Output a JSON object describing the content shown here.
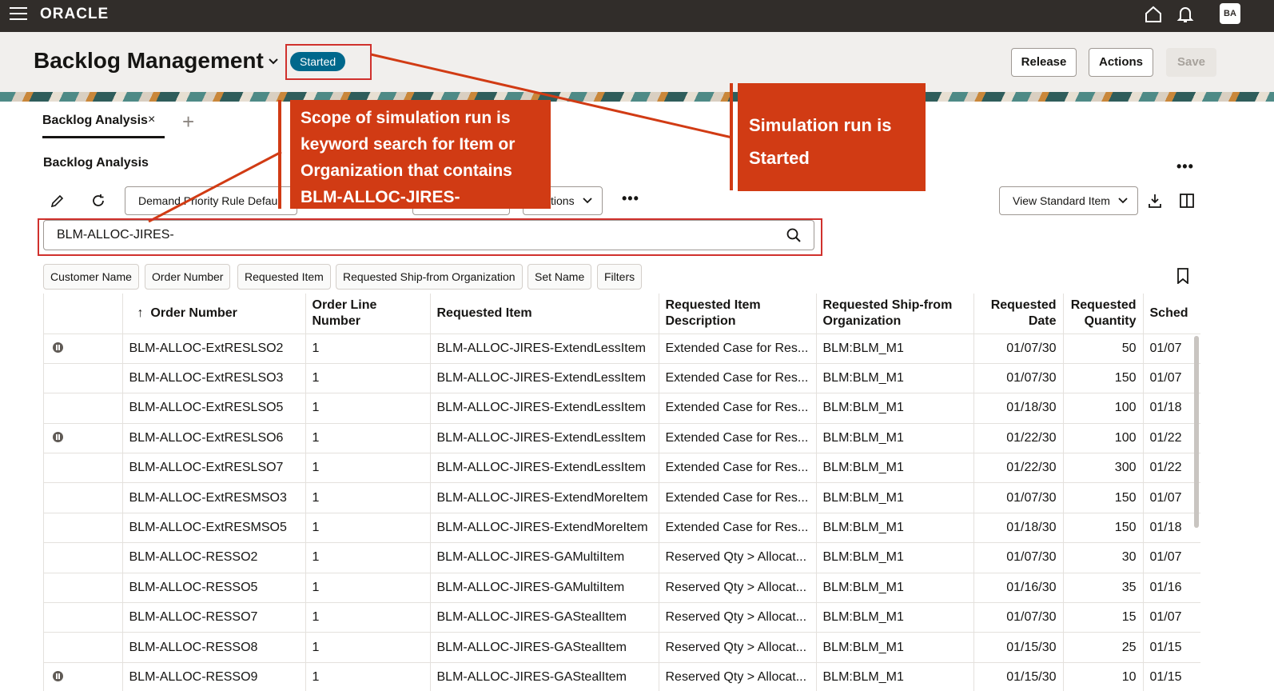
{
  "topbar": {
    "brand": "ORACLE",
    "avatar_initials": "BA"
  },
  "header": {
    "title": "Backlog Management",
    "status": "Started",
    "buttons": {
      "release": "Release",
      "actions": "Actions",
      "save": "Save"
    }
  },
  "tabs": {
    "active": "Backlog Analysis",
    "close": "×",
    "add": "+"
  },
  "section": {
    "title": "Backlog Analysis",
    "more": "•••"
  },
  "toolbar": {
    "rule_select": "Demand Priority Rule Defaul",
    "select_2": "",
    "options_select": "tions",
    "more": "•••",
    "view_select": "View Standard Item"
  },
  "search": {
    "value": "BLM-ALLOC-JIRES-"
  },
  "chips": [
    "Customer Name",
    "Order Number",
    "Requested Item",
    "Requested Ship-from Organization",
    "Set Name",
    "Filters"
  ],
  "table": {
    "sort_arrow": "↑",
    "headers": [
      "Order Number",
      "Order Line Number",
      "Requested Item",
      "Requested Item Description",
      "Requested Ship-from Organization",
      "Requested Date",
      "Requested Quantity",
      "Sched"
    ],
    "rows": [
      {
        "paused": true,
        "order": "BLM-ALLOC-ExtRESLSO2",
        "line": "1",
        "item": "BLM-ALLOC-JIRES-ExtendLessItem",
        "desc": "Extended Case for Res...",
        "org": "BLM:BLM_M1",
        "date": "01/07/30",
        "qty": "50",
        "sched": "01/07"
      },
      {
        "paused": false,
        "order": "BLM-ALLOC-ExtRESLSO3",
        "line": "1",
        "item": "BLM-ALLOC-JIRES-ExtendLessItem",
        "desc": "Extended Case for Res...",
        "org": "BLM:BLM_M1",
        "date": "01/07/30",
        "qty": "150",
        "sched": "01/07"
      },
      {
        "paused": false,
        "order": "BLM-ALLOC-ExtRESLSO5",
        "line": "1",
        "item": "BLM-ALLOC-JIRES-ExtendLessItem",
        "desc": "Extended Case for Res...",
        "org": "BLM:BLM_M1",
        "date": "01/18/30",
        "qty": "100",
        "sched": "01/18"
      },
      {
        "paused": true,
        "order": "BLM-ALLOC-ExtRESLSO6",
        "line": "1",
        "item": "BLM-ALLOC-JIRES-ExtendLessItem",
        "desc": "Extended Case for Res...",
        "org": "BLM:BLM_M1",
        "date": "01/22/30",
        "qty": "100",
        "sched": "01/22"
      },
      {
        "paused": false,
        "order": "BLM-ALLOC-ExtRESLSO7",
        "line": "1",
        "item": "BLM-ALLOC-JIRES-ExtendLessItem",
        "desc": "Extended Case for Res...",
        "org": "BLM:BLM_M1",
        "date": "01/22/30",
        "qty": "300",
        "sched": "01/22"
      },
      {
        "paused": false,
        "order": "BLM-ALLOC-ExtRESMSO3",
        "line": "1",
        "item": "BLM-ALLOC-JIRES-ExtendMoreItem",
        "desc": "Extended Case for Res...",
        "org": "BLM:BLM_M1",
        "date": "01/07/30",
        "qty": "150",
        "sched": "01/07"
      },
      {
        "paused": false,
        "order": "BLM-ALLOC-ExtRESMSO5",
        "line": "1",
        "item": "BLM-ALLOC-JIRES-ExtendMoreItem",
        "desc": "Extended Case for Res...",
        "org": "BLM:BLM_M1",
        "date": "01/18/30",
        "qty": "150",
        "sched": "01/18"
      },
      {
        "paused": false,
        "order": "BLM-ALLOC-RESSO2",
        "line": "1",
        "item": "BLM-ALLOC-JIRES-GAMultiItem",
        "desc": "Reserved Qty > Allocat...",
        "org": "BLM:BLM_M1",
        "date": "01/07/30",
        "qty": "30",
        "sched": "01/07"
      },
      {
        "paused": false,
        "order": "BLM-ALLOC-RESSO5",
        "line": "1",
        "item": "BLM-ALLOC-JIRES-GAMultiItem",
        "desc": "Reserved Qty > Allocat...",
        "org": "BLM:BLM_M1",
        "date": "01/16/30",
        "qty": "35",
        "sched": "01/16"
      },
      {
        "paused": false,
        "order": "BLM-ALLOC-RESSO7",
        "line": "1",
        "item": "BLM-ALLOC-JIRES-GAStealItem",
        "desc": "Reserved Qty > Allocat...",
        "org": "BLM:BLM_M1",
        "date": "01/07/30",
        "qty": "15",
        "sched": "01/07"
      },
      {
        "paused": false,
        "order": "BLM-ALLOC-RESSO8",
        "line": "1",
        "item": "BLM-ALLOC-JIRES-GAStealItem",
        "desc": "Reserved Qty > Allocat...",
        "org": "BLM:BLM_M1",
        "date": "01/15/30",
        "qty": "25",
        "sched": "01/15"
      },
      {
        "paused": true,
        "order": "BLM-ALLOC-RESSO9",
        "line": "1",
        "item": "BLM-ALLOC-JIRES-GAStealItem",
        "desc": "Reserved Qty > Allocat...",
        "org": "BLM:BLM_M1",
        "date": "01/15/30",
        "qty": "10",
        "sched": "01/15"
      }
    ]
  },
  "annotations": {
    "scope": "Scope of simulation run is keyword search for Item or Organization that contains BLM-ALLOC-JIRES-",
    "started": "Simulation run is Started",
    "color": "#d13b14"
  }
}
